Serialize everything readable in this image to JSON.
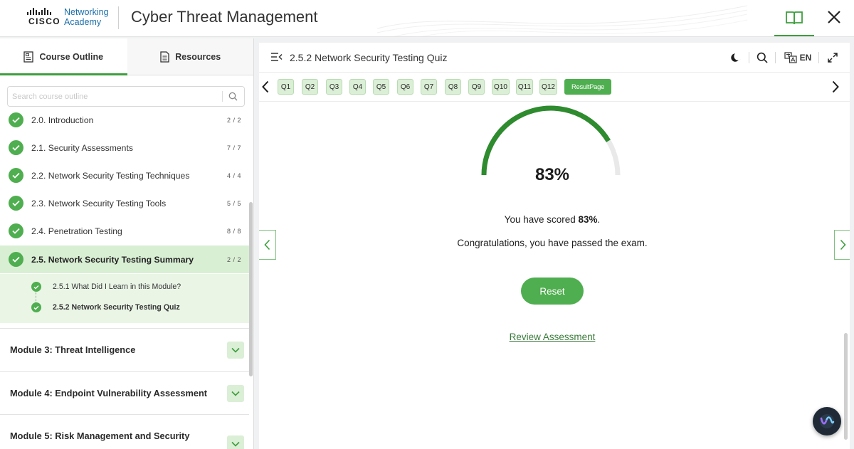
{
  "brand": {
    "cisco": "CISCO",
    "academy_line1": "Networking",
    "academy_line2": "Academy"
  },
  "app_title": "Cyber Threat Management",
  "header_icons": {
    "book": "book-icon",
    "close": "close-icon"
  },
  "sidebar": {
    "tabs": [
      {
        "label": "Course Outline",
        "icon": "outline-icon",
        "active": true
      },
      {
        "label": "Resources",
        "icon": "document-icon",
        "active": false
      }
    ],
    "search_placeholder": "Search course outline",
    "items": [
      {
        "label": "2.0. Introduction",
        "count": "2 / 2"
      },
      {
        "label": "2.1. Security Assessments",
        "count": "7 / 7"
      },
      {
        "label": "2.2. Network Security Testing Techniques",
        "count": "4 / 4"
      },
      {
        "label": "2.3. Network Security Testing Tools",
        "count": "5 / 5"
      },
      {
        "label": "2.4. Penetration Testing",
        "count": "8 / 8"
      },
      {
        "label": "2.5. Network Security Testing Summary",
        "count": "2 / 2"
      }
    ],
    "subitems": [
      {
        "label": "2.5.1 What Did I Learn in this Module?"
      },
      {
        "label": "2.5.2 Network Security Testing Quiz"
      }
    ],
    "modules": [
      {
        "label": "Module 3: Threat Intelligence"
      },
      {
        "label": "Module 4: Endpoint Vulnerability Assessment"
      },
      {
        "label": "Module 5: Risk Management and Security"
      }
    ]
  },
  "main": {
    "title": "2.5.2 Network Security Testing Quiz",
    "language": "EN",
    "questions": [
      "Q1",
      "Q2",
      "Q3",
      "Q4",
      "Q5",
      "Q6",
      "Q7",
      "Q8",
      "Q9",
      "Q10",
      "Q11",
      "Q12"
    ],
    "result_label": "ResultPage",
    "score_percent": "83%",
    "score_fraction": 0.83,
    "score_prefix": "You have scored ",
    "score_value": "83%",
    "score_suffix": ".",
    "congrats": "Congratulations, you have passed the exam.",
    "reset_label": "Reset",
    "review_label": "Review Assessment"
  },
  "colors": {
    "accent": "#4fae4f",
    "accent_dark": "#2e8b2e",
    "accent_light": "#dbeed6",
    "gauge_track": "#e9e9e9"
  }
}
